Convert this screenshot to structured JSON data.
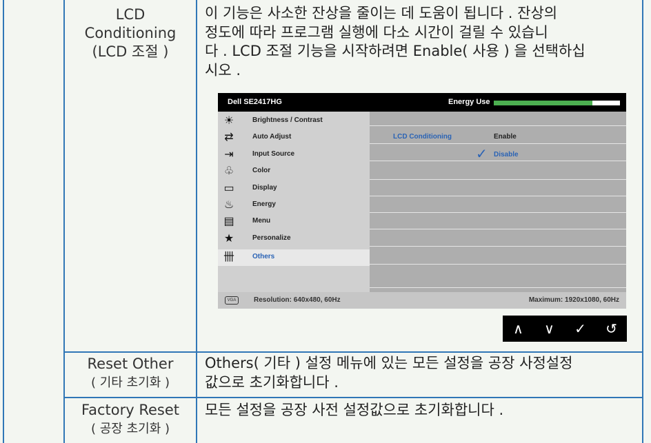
{
  "rows": [
    {
      "label_lines": [
        "LCD",
        "Conditioning",
        "(LCD 조절 )"
      ],
      "desc_lines": [
        "이 기능은 사소한 잔상을 줄이는 데 도움이 됩니다 . 잔상의",
        "정도에 따라 프로그램 실행에 다소 시간이 걸릴 수 있습니",
        "다 . LCD 조절 기능을 시작하려면 Enable( 사용 ) 을 선택하십",
        "시오 ."
      ]
    },
    {
      "label_lines": [
        "Reset Other",
        "( 기타 초기화 )"
      ],
      "desc_lines": [
        "Others( 기타 ) 설정 메뉴에 있는 모든 설정을 공장 사정설정",
        "값으로 초기화합니다 ."
      ]
    },
    {
      "label_lines": [
        "Factory Reset",
        "( 공장 초기화 )"
      ],
      "desc_lines": [
        "모든 설정을 공장 사전 설정값으로 초기화합니다 ."
      ]
    }
  ],
  "osd": {
    "title": "Dell SE2417HG",
    "energy_label": "Energy Use",
    "energy_level": 0.78,
    "menu_items": [
      {
        "label": "Brightness / Contrast",
        "icon": "brightness-icon",
        "glyph": "☀"
      },
      {
        "label": "Auto Adjust",
        "icon": "auto-adjust-icon",
        "glyph": "⇄"
      },
      {
        "label": "Input Source",
        "icon": "input-source-icon",
        "glyph": "⇥"
      },
      {
        "label": "Color",
        "icon": "color-icon",
        "glyph": "♧"
      },
      {
        "label": "Display",
        "icon": "display-icon",
        "glyph": "▭"
      },
      {
        "label": "Energy",
        "icon": "energy-icon",
        "glyph": "♨"
      },
      {
        "label": "Menu",
        "icon": "menu-icon",
        "glyph": "▤"
      },
      {
        "label": "Personalize",
        "icon": "star-icon",
        "glyph": "★"
      },
      {
        "label": "Others",
        "icon": "others-icon",
        "glyph": "卌"
      }
    ],
    "selected_item": "Others",
    "option_key": "LCD Conditioning",
    "option_enable": "Enable",
    "option_disable": "Disable",
    "checkmark": "✓",
    "footer_left": "Resolution: 640x480, 60Hz",
    "footer_right": "Maximum: 1920x1080, 60Hz",
    "connector_label": "VGA"
  },
  "nav_buttons": [
    {
      "name": "up-button",
      "glyph": "∧"
    },
    {
      "name": "down-button",
      "glyph": "∨"
    },
    {
      "name": "check-button",
      "glyph": "✓"
    },
    {
      "name": "back-button",
      "glyph": "↺"
    }
  ],
  "colors": {
    "border": "#2f76b6",
    "highlight": "#2a63b5",
    "energy": "#4caf50"
  }
}
